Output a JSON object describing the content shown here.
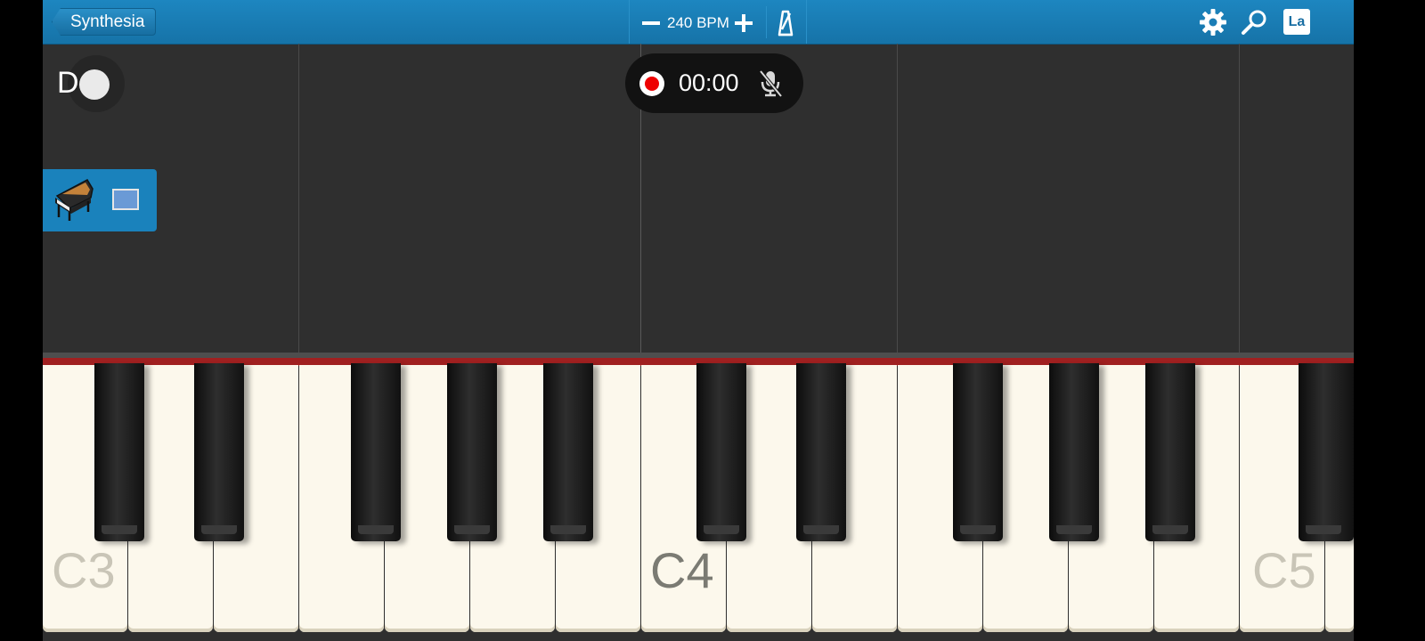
{
  "topbar": {
    "back_label": "Synthesia",
    "tempo_label": "240 BPM",
    "la_label": "La"
  },
  "track": {
    "do_label": "D",
    "record_time": "00:00"
  },
  "keyboard": {
    "labels": [
      "C3",
      "C4",
      "C5"
    ]
  },
  "colors": {
    "topbar": "#1a7db6",
    "instrument_panel": "#1a82bc",
    "record_dot": "#ee0000",
    "felt": "#a02020",
    "white_key": "#fcf8ec",
    "track_bg": "#2f2f2f"
  },
  "icons": [
    "back-chevron-icon",
    "minus-icon",
    "plus-icon",
    "metronome-icon",
    "gear-icon",
    "magnifier-icon",
    "record-icon",
    "mic-muted-icon",
    "grand-piano-icon",
    "screen-icon"
  ]
}
